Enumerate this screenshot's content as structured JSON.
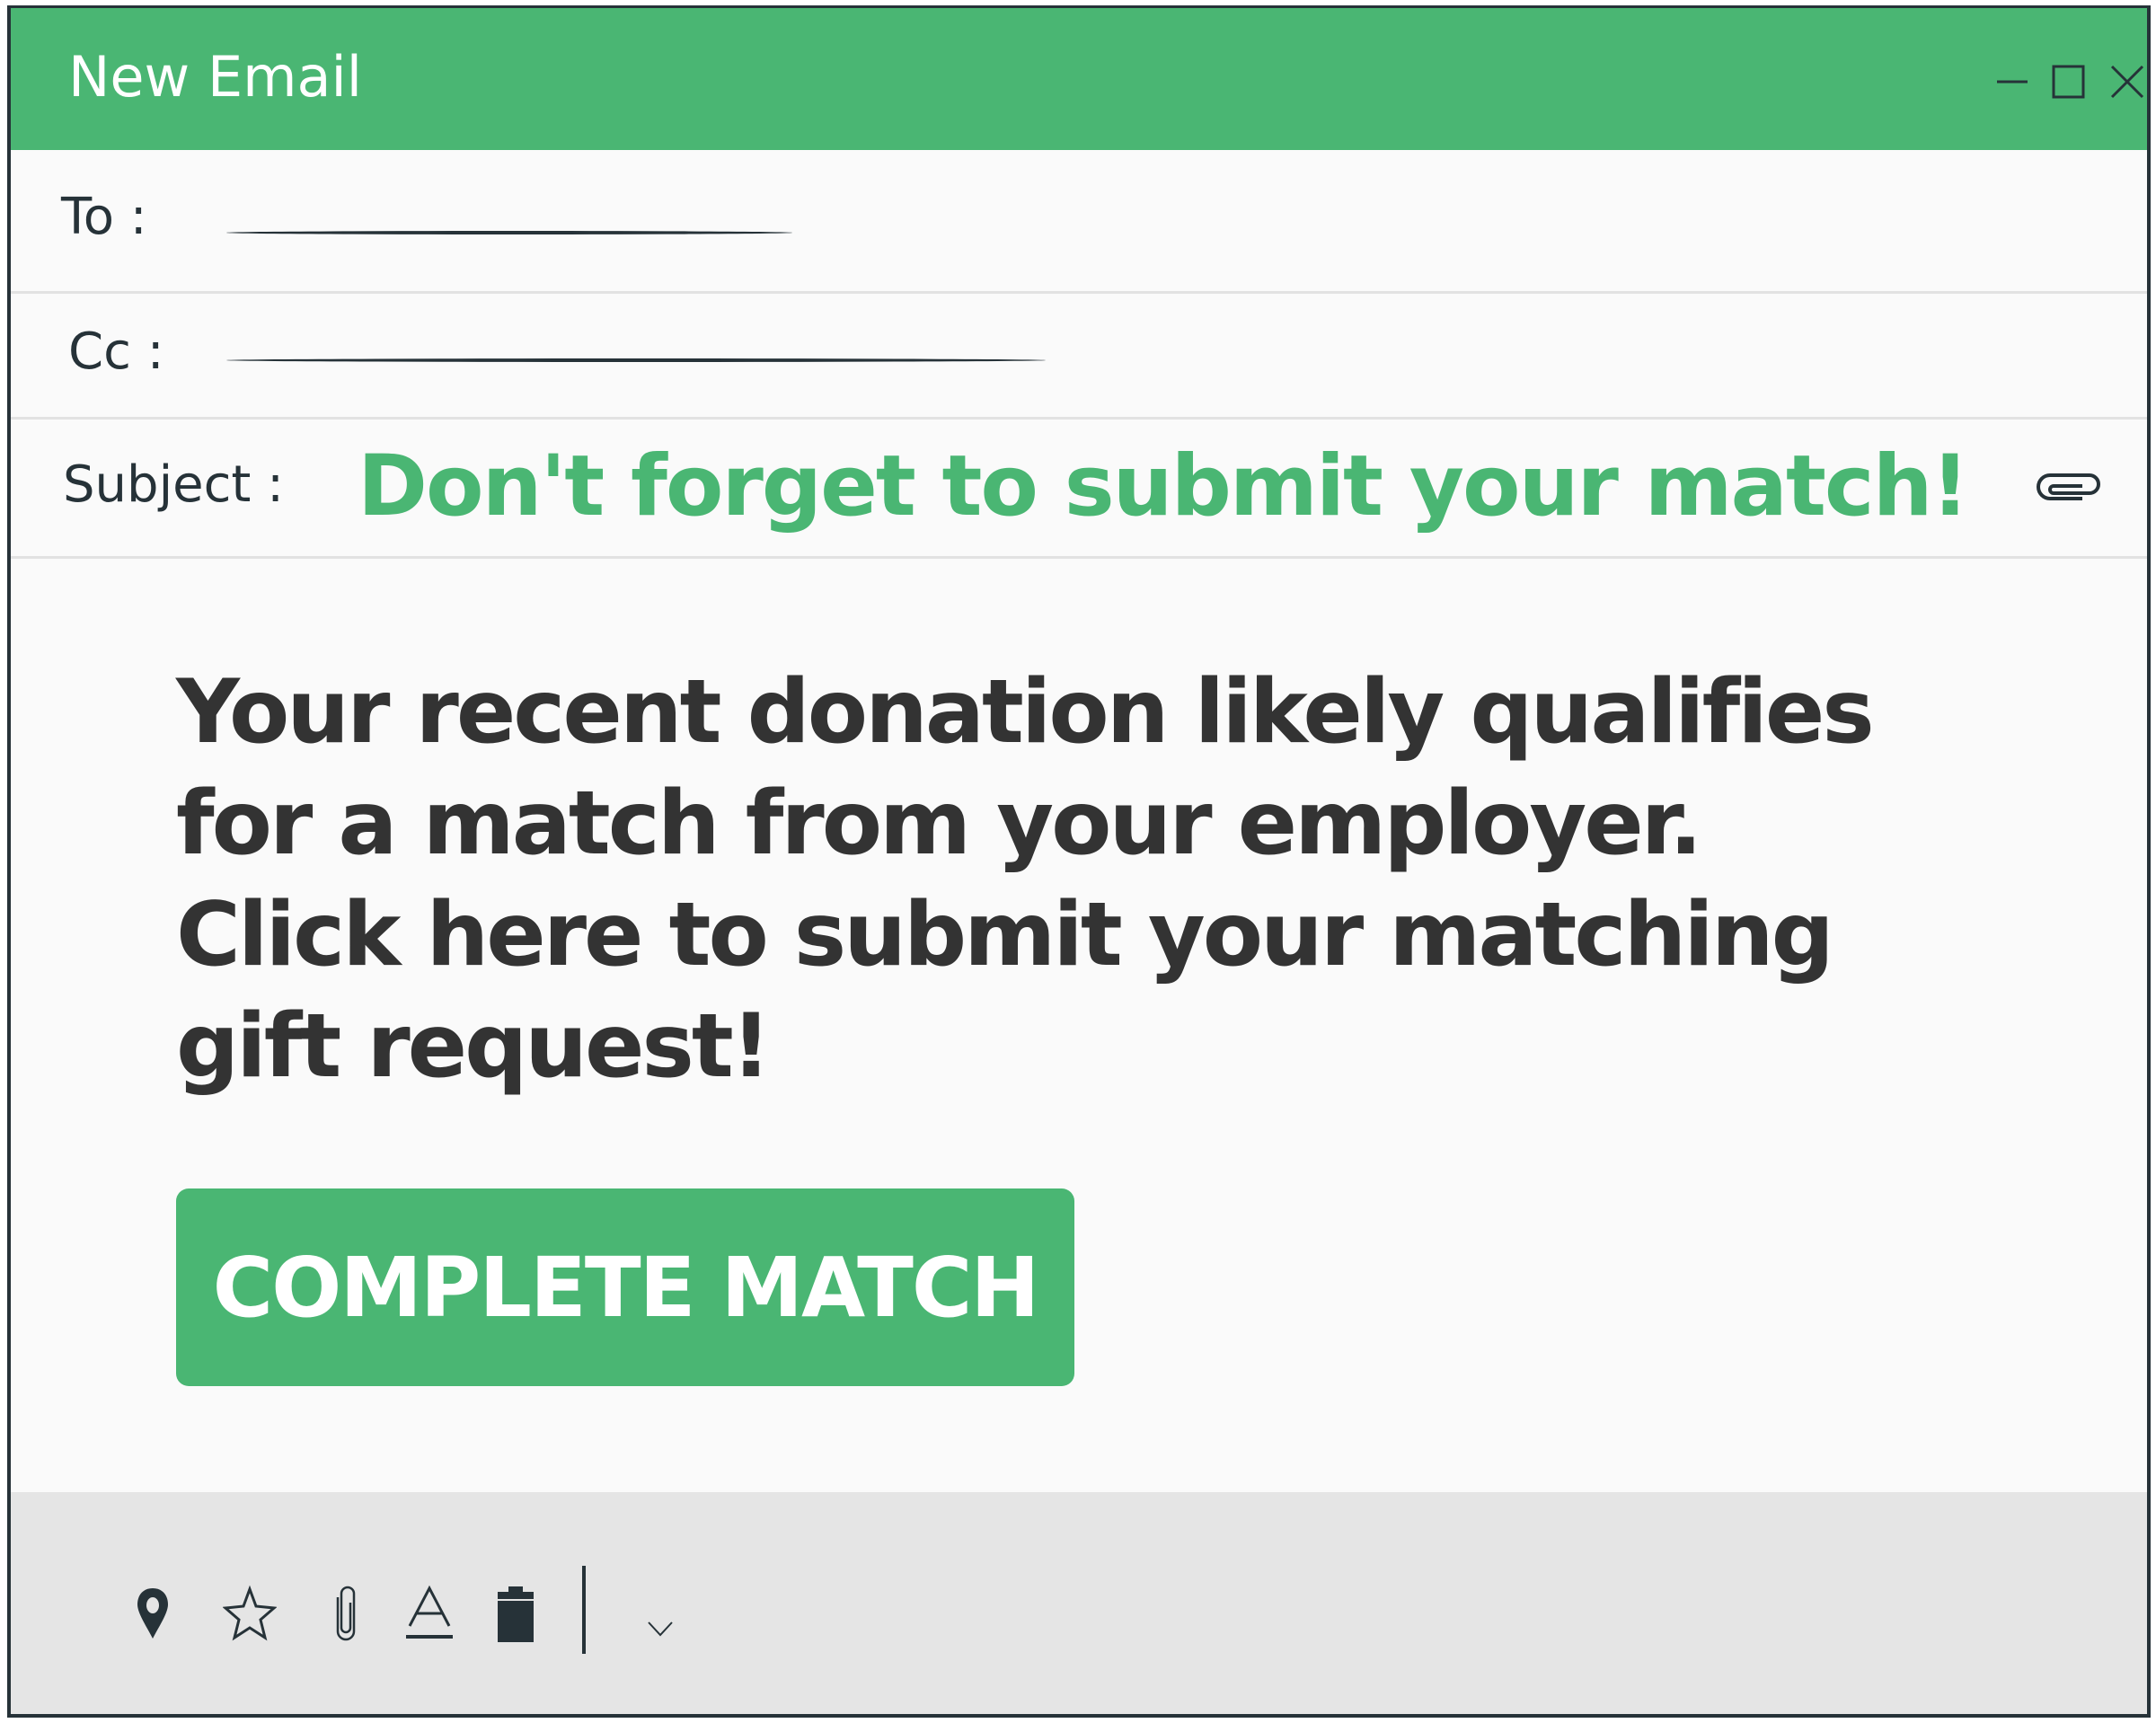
{
  "window": {
    "title": "New Email",
    "controls": [
      "minimize",
      "maximize",
      "close"
    ]
  },
  "fields": {
    "to": {
      "label": "To :",
      "value": ""
    },
    "cc": {
      "label": "Cc :",
      "value": ""
    },
    "subject": {
      "label": "Subject :",
      "value": "Don't forget to submit your match!"
    }
  },
  "body": {
    "lines": [
      "Your recent donation likely qualifies",
      "for a match from your employer.",
      "Click here to submit your matching",
      "gift request!"
    ],
    "cta_label": "COMPLETE MATCH"
  },
  "toolbar": {
    "icons": [
      "location-pin-icon",
      "star-icon",
      "paperclip-icon",
      "text-format-icon",
      "trash-icon",
      "chevron-down-icon"
    ]
  },
  "colors": {
    "accent": "#4ab673",
    "text_dark": "#263238",
    "body_text": "#333333",
    "background": "#fafafa",
    "footer": "#e5e5e5"
  }
}
